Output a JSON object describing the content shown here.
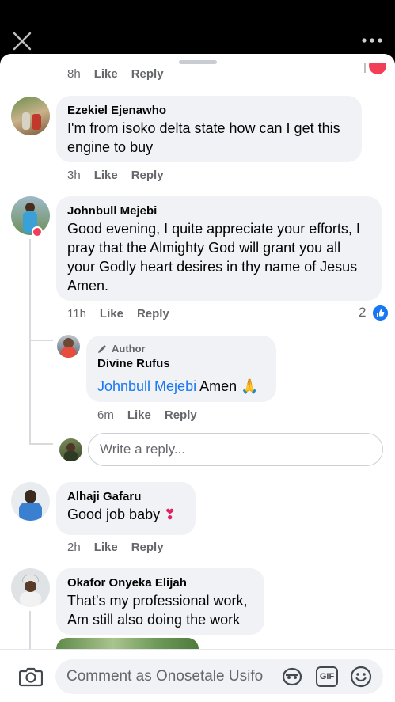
{
  "header": {
    "close_icon": "close-icon",
    "more_icon": "more-icon"
  },
  "top_partial": {
    "time": "8h",
    "like": "Like",
    "reply": "Reply"
  },
  "comments": [
    {
      "author": "Ezekiel Ejenawho",
      "text": "I'm from isoko delta state how can I get this engine to buy",
      "time": "3h",
      "like": "Like",
      "reply": "Reply"
    },
    {
      "author": "Johnbull Mejebi",
      "text": "Good evening, I quite appreciate your efforts, I pray that the Almighty God will grant you all your Godly heart desires in thy name of Jesus Amen.",
      "time": "11h",
      "like": "Like",
      "reply": "Reply",
      "reaction_count": "2",
      "replies": [
        {
          "tag": "Author",
          "author": "Divine Rufus",
          "mention": "Johnbull Mejebi",
          "text": "Amen",
          "emoji": "🙏",
          "time": "6m",
          "like": "Like",
          "reply": "Reply"
        }
      ],
      "reply_placeholder": "Write a reply..."
    },
    {
      "author": "Alhaji Gafaru",
      "text": "Good job baby",
      "emoji": "❣",
      "time": "2h",
      "like": "Like",
      "reply": "Reply"
    },
    {
      "author": "Okafor Onyeka Elijah",
      "text": "That's my professional work, Am still also doing the work"
    }
  ],
  "composer": {
    "placeholder": "Comment as Onosetale Usifo",
    "gif_label": "GIF"
  },
  "colors": {
    "accent": "#1877f2",
    "bubble": "#f0f2f5",
    "meta": "#65676b"
  }
}
